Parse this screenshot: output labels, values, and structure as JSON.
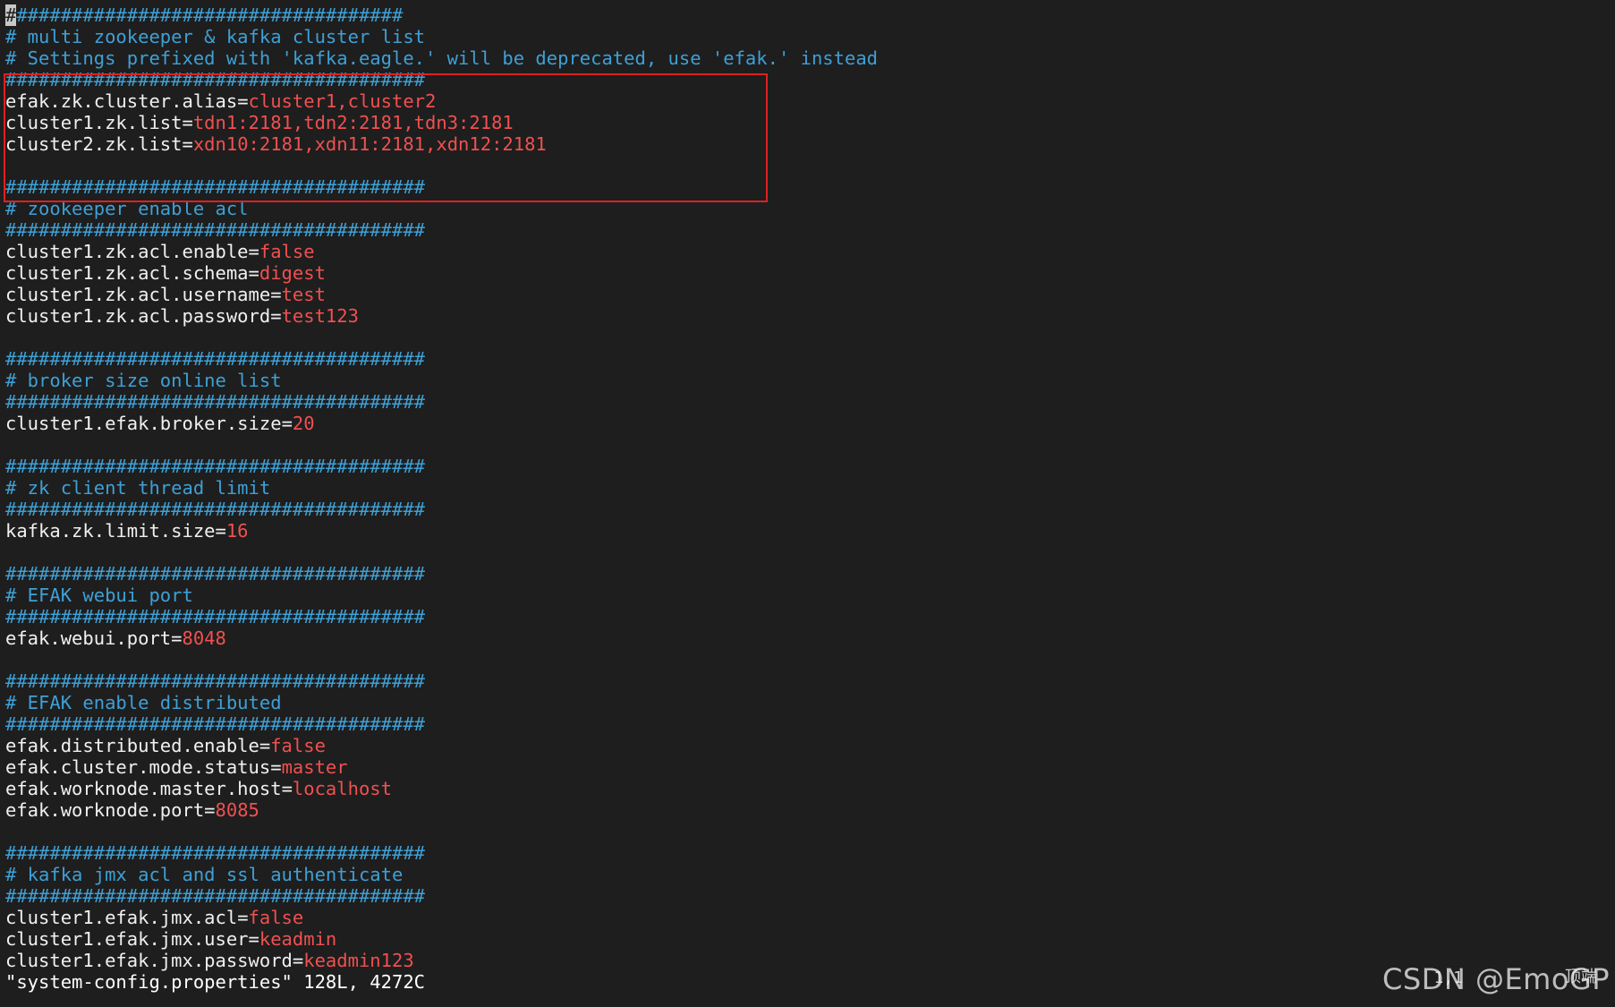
{
  "editor": {
    "lines": [
      {
        "type": "cursor-comment",
        "cursor": "#",
        "text": "###################################"
      },
      {
        "type": "comment",
        "text": "# multi zookeeper & kafka cluster list"
      },
      {
        "type": "comment",
        "text": "# Settings prefixed with 'kafka.eagle.' will be deprecated, use 'efak.' instead"
      },
      {
        "type": "comment",
        "text": "######################################"
      },
      {
        "type": "kv",
        "key": "efak.zk.cluster.alias",
        "value": "cluster1,cluster2"
      },
      {
        "type": "kv",
        "key": "cluster1.zk.list",
        "value": "tdn1:2181,tdn2:2181,tdn3:2181"
      },
      {
        "type": "kv",
        "key": "cluster2.zk.list",
        "value": "xdn10:2181,xdn11:2181,xdn12:2181"
      },
      {
        "type": "blank",
        "text": ""
      },
      {
        "type": "comment",
        "text": "######################################"
      },
      {
        "type": "comment",
        "text": "# zookeeper enable acl"
      },
      {
        "type": "comment",
        "text": "######################################"
      },
      {
        "type": "kv",
        "key": "cluster1.zk.acl.enable",
        "value": "false"
      },
      {
        "type": "kv",
        "key": "cluster1.zk.acl.schema",
        "value": "digest"
      },
      {
        "type": "kv",
        "key": "cluster1.zk.acl.username",
        "value": "test"
      },
      {
        "type": "kv",
        "key": "cluster1.zk.acl.password",
        "value": "test123"
      },
      {
        "type": "blank",
        "text": ""
      },
      {
        "type": "comment",
        "text": "######################################"
      },
      {
        "type": "comment",
        "text": "# broker size online list"
      },
      {
        "type": "comment",
        "text": "######################################"
      },
      {
        "type": "kv",
        "key": "cluster1.efak.broker.size",
        "value": "20"
      },
      {
        "type": "blank",
        "text": ""
      },
      {
        "type": "comment",
        "text": "######################################"
      },
      {
        "type": "comment",
        "text": "# zk client thread limit"
      },
      {
        "type": "comment",
        "text": "######################################"
      },
      {
        "type": "kv",
        "key": "kafka.zk.limit.size",
        "value": "16"
      },
      {
        "type": "blank",
        "text": ""
      },
      {
        "type": "comment",
        "text": "######################################"
      },
      {
        "type": "comment",
        "text": "# EFAK webui port"
      },
      {
        "type": "comment",
        "text": "######################################"
      },
      {
        "type": "kv",
        "key": "efak.webui.port",
        "value": "8048"
      },
      {
        "type": "blank",
        "text": ""
      },
      {
        "type": "comment",
        "text": "######################################"
      },
      {
        "type": "comment",
        "text": "# EFAK enable distributed"
      },
      {
        "type": "comment",
        "text": "######################################"
      },
      {
        "type": "kv",
        "key": "efak.distributed.enable",
        "value": "false"
      },
      {
        "type": "kv",
        "key": "efak.cluster.mode.status",
        "value": "master"
      },
      {
        "type": "kv",
        "key": "efak.worknode.master.host",
        "value": "localhost"
      },
      {
        "type": "kv",
        "key": "efak.worknode.port",
        "value": "8085"
      },
      {
        "type": "blank",
        "text": ""
      },
      {
        "type": "comment",
        "text": "######################################"
      },
      {
        "type": "comment",
        "text": "# kafka jmx acl and ssl authenticate"
      },
      {
        "type": "comment",
        "text": "######################################"
      },
      {
        "type": "kv",
        "key": "cluster1.efak.jmx.acl",
        "value": "false"
      },
      {
        "type": "kv",
        "key": "cluster1.efak.jmx.user",
        "value": "keadmin"
      },
      {
        "type": "kv",
        "key": "cluster1.efak.jmx.password",
        "value": "keadmin123"
      },
      {
        "type": "status",
        "text": "\"system-config.properties\" 128L, 4272C"
      }
    ],
    "equals_sign": "="
  },
  "statusbar": {
    "position": "1,1",
    "scroll": "顶端"
  },
  "watermark": {
    "text": "CSDN @EmoGP"
  },
  "colors": {
    "background": "#1e1e1e",
    "comment": "#3ea0d6",
    "key": "#f0f0f0",
    "value": "#f05050",
    "highlight_box": "#e02020"
  }
}
